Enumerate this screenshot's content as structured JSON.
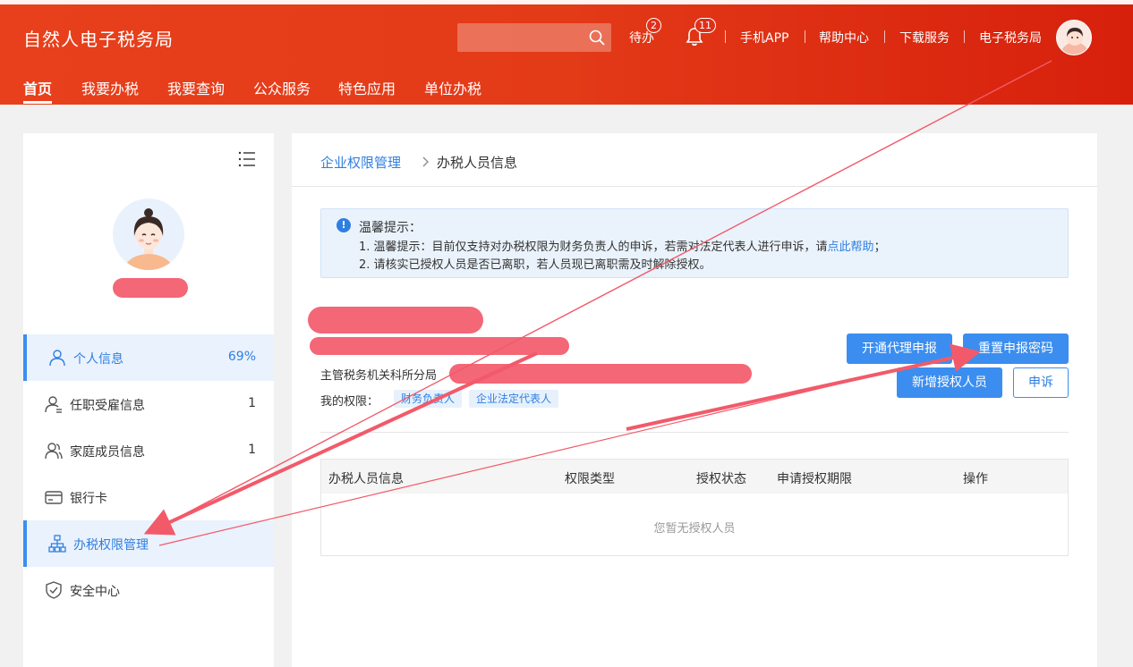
{
  "header": {
    "brand": "自然人电子税务局",
    "search_placeholder": "",
    "links": {
      "todo": "待办",
      "todo_count": "2",
      "notify_count": "11",
      "app": "手机APP",
      "help": "帮助中心",
      "download": "下载服务",
      "etax": "电子税务局"
    },
    "nav": [
      "首页",
      "我要办税",
      "我要查询",
      "公众服务",
      "特色应用",
      "单位办税"
    ]
  },
  "sidebar": {
    "items": [
      {
        "label": "个人信息",
        "count": "69%",
        "icon": "person-icon"
      },
      {
        "label": "任职受雇信息",
        "count": "1",
        "icon": "employee-icon"
      },
      {
        "label": "家庭成员信息",
        "count": "1",
        "icon": "family-icon"
      },
      {
        "label": "银行卡",
        "count": "",
        "icon": "card-icon"
      },
      {
        "label": "办税权限管理",
        "count": "",
        "icon": "org-icon"
      },
      {
        "label": "安全中心",
        "count": "",
        "icon": "shield-icon"
      }
    ]
  },
  "main": {
    "breadcrumb": {
      "parent": "企业权限管理",
      "current": "办税人员信息"
    },
    "notice": {
      "title": "温馨提示：",
      "line1": "1. 温馨提示：目前仅支持对办税权限为财务负责人的申诉，若需对法定代表人进行申诉，请",
      "line1_link": "点此帮助",
      "line1_end": "；",
      "line2": "2. 请核实已授权人员是否已离职，若人员现已离职需及时解除授权。"
    },
    "org_label": "主管税务机关科所分局",
    "perm_label": "我的权限：",
    "tags": [
      "财务负责人",
      "企业法定代表人"
    ],
    "buttons": {
      "open_proxy": "开通代理申报",
      "reset_pwd": "重置申报密码",
      "add_person": "新增授权人员",
      "appeal": "申诉"
    },
    "table": {
      "headers": [
        "办税人员信息",
        "权限类型",
        "授权状态",
        "申请授权期限",
        "操作"
      ],
      "empty_text": "您暂无授权人员"
    }
  },
  "colors": {
    "header_start": "#e8401c",
    "header_end": "#d7200c",
    "accent": "#3b8ef0",
    "annotation": "#f25a6a"
  }
}
